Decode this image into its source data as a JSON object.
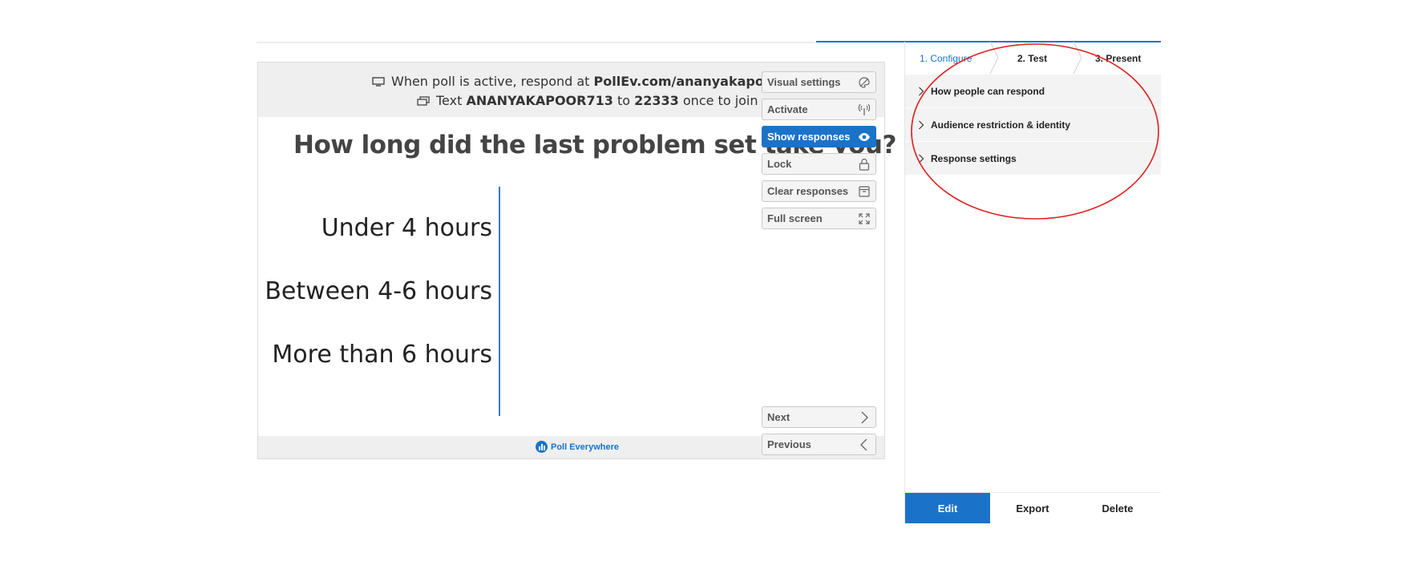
{
  "poll": {
    "header_line1_prefix": "When poll is active, respond at",
    "header_line1_url": "PollEv.com/ananyakapoor713",
    "header_line2_prefix": "Text",
    "header_line2_code": "ANANYAKAPOOR713",
    "header_line2_to": "to",
    "header_line2_number": "22333",
    "header_line2_suffix": "once to join",
    "question": "How long did the last problem set take you?",
    "options": [
      "Under 4 hours",
      "Between 4-6 hours",
      "More than 6 hours"
    ],
    "brand": "Poll Everywhere"
  },
  "controls": {
    "visual_settings": "Visual settings",
    "activate": "Activate",
    "show_responses": "Show responses",
    "lock": "Lock",
    "clear_responses": "Clear responses",
    "full_screen": "Full screen",
    "next": "Next",
    "previous": "Previous"
  },
  "steps": [
    "1. Configure",
    "2. Test",
    "3. Present"
  ],
  "accordion": [
    "How people can respond",
    "Audience restriction & identity",
    "Response settings"
  ],
  "actions": {
    "edit": "Edit",
    "export": "Export",
    "delete": "Delete"
  },
  "colors": {
    "accent": "#1a73c8",
    "annotation": "#e02020"
  }
}
